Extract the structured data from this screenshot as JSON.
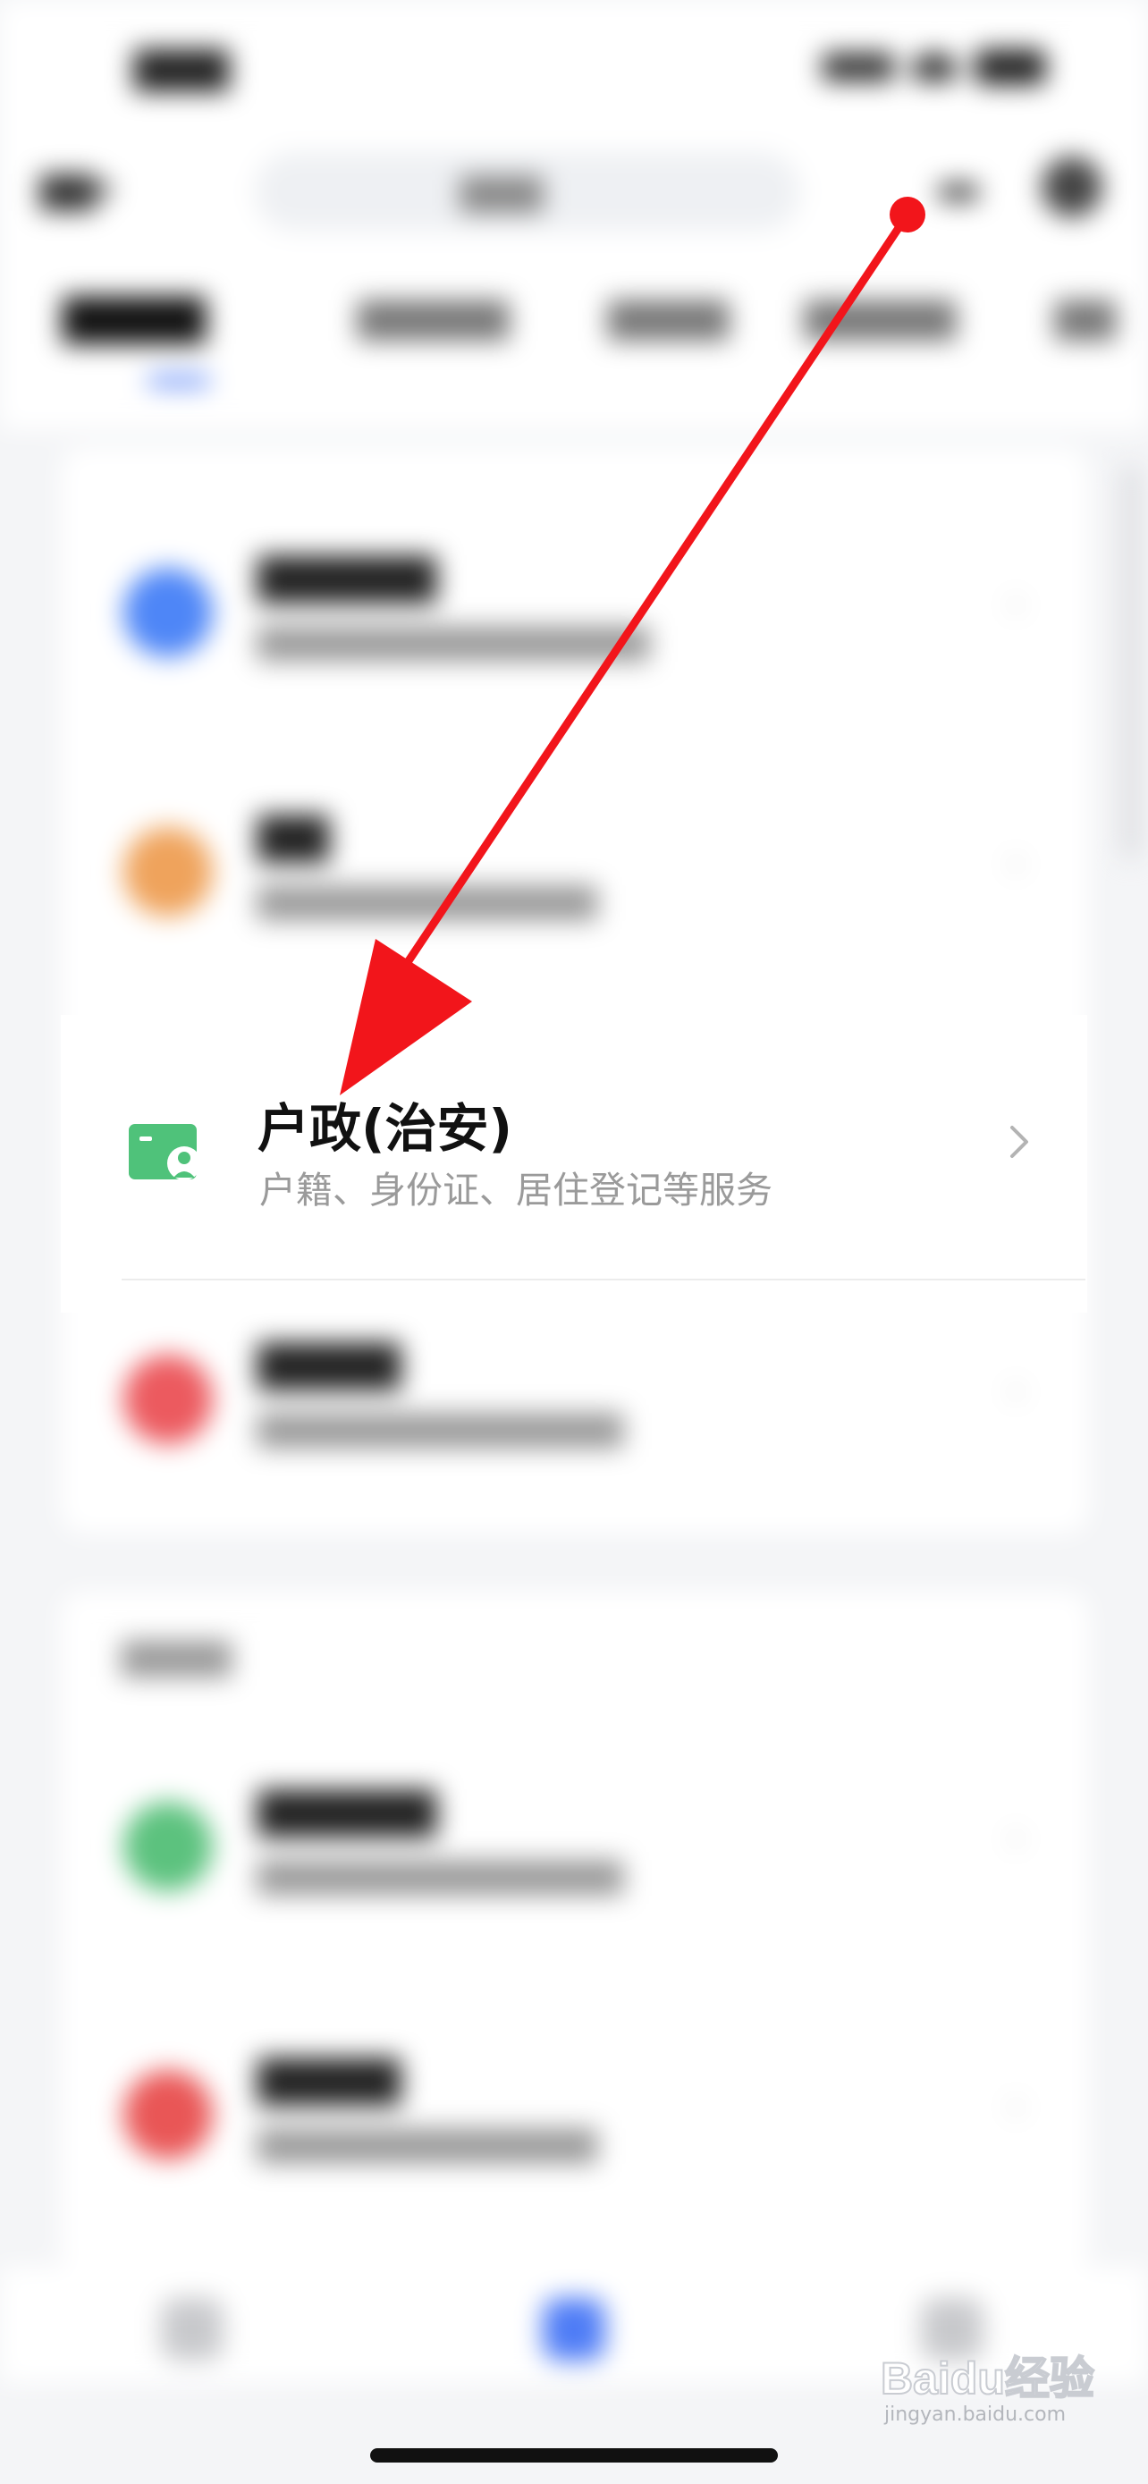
{
  "highlighted_item": {
    "title": "户政(治安)",
    "subtitle": "户籍、身份证、居住登记等服务",
    "icon": "id-card-person-icon",
    "icon_color": "#4fc27a"
  },
  "annotation": {
    "arrow_color": "#f2151b"
  },
  "watermark": {
    "brand": "Baidu经验",
    "url": "jingyan.baidu.com"
  },
  "colors": {
    "accent": "#4e7cf6",
    "background": "#f4f5f7"
  }
}
